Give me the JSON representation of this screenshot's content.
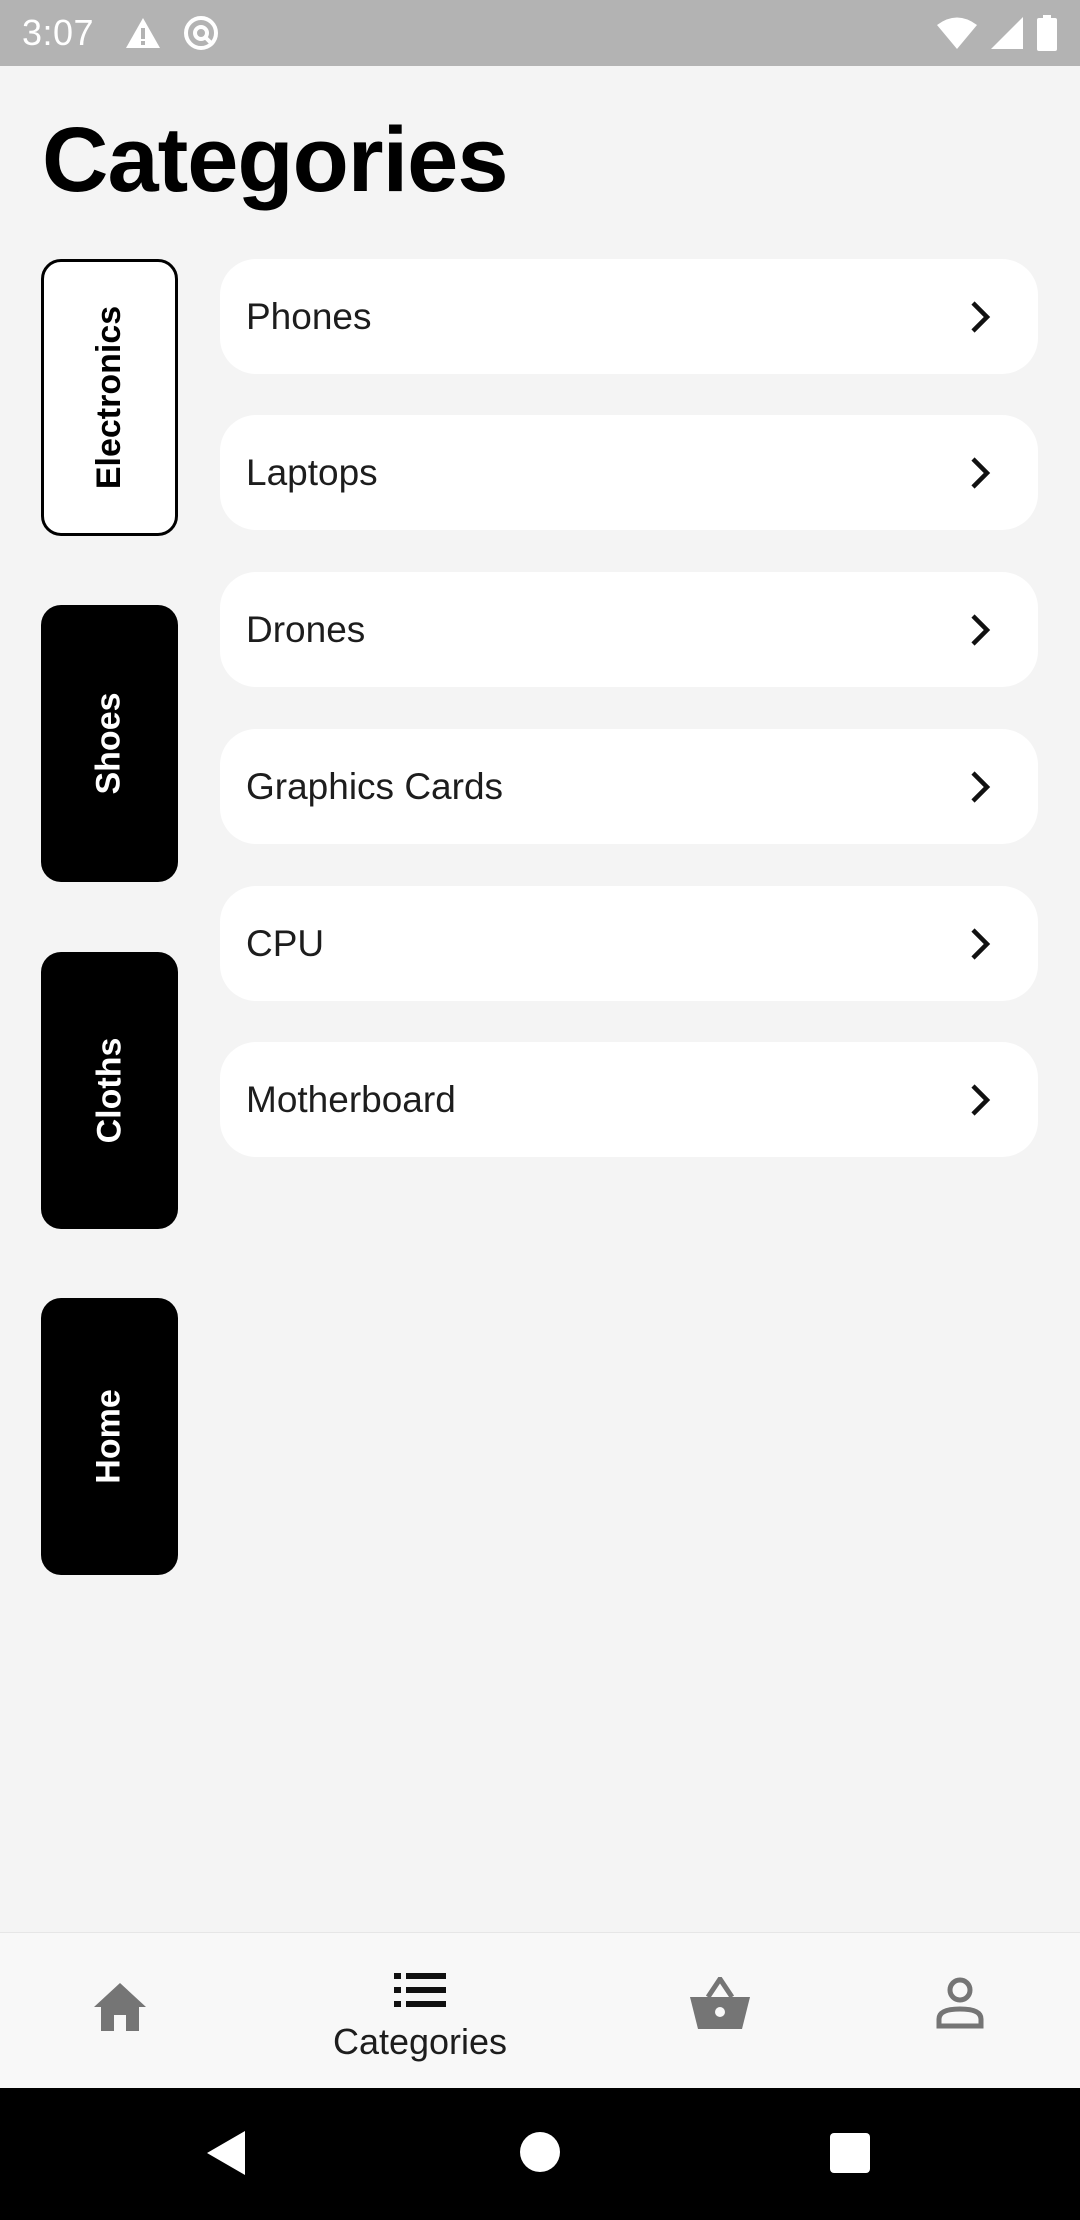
{
  "status_bar": {
    "time": "3:07",
    "left_icons": [
      "alert-icon",
      "data-saver-icon"
    ],
    "right_icons": [
      "wifi-icon",
      "signal-icon",
      "battery-icon"
    ]
  },
  "page": {
    "title": "Categories"
  },
  "categories": [
    {
      "label": "Electronics",
      "active": true
    },
    {
      "label": "Shoes",
      "active": false
    },
    {
      "label": "Cloths",
      "active": false
    },
    {
      "label": "Home",
      "active": false
    }
  ],
  "subcategories": [
    {
      "label": "Phones",
      "icon": "chevron-right-icon"
    },
    {
      "label": "Laptops",
      "icon": "chevron-right-icon"
    },
    {
      "label": "Drones",
      "icon": "chevron-right-icon"
    },
    {
      "label": "Graphics Cards",
      "icon": "chevron-right-icon"
    },
    {
      "label": "CPU",
      "icon": "chevron-right-icon"
    },
    {
      "label": "Motherboard",
      "icon": "chevron-right-icon"
    }
  ],
  "bottom_nav": {
    "items": [
      {
        "icon": "home-icon",
        "label": ""
      },
      {
        "icon": "list-icon",
        "label": "Categories",
        "selected": true
      },
      {
        "icon": "basket-icon",
        "label": ""
      },
      {
        "icon": "person-icon",
        "label": ""
      }
    ]
  },
  "system_nav": [
    "back-icon",
    "home-circle-icon",
    "recents-icon"
  ],
  "colors": {
    "background": "#f4f4f4",
    "status_bar": "#b3b3b3",
    "tab_active_bg": "#ffffff",
    "tab_inactive_bg": "#000000",
    "card_bg": "#ffffff",
    "nav_icon": "#757575"
  }
}
